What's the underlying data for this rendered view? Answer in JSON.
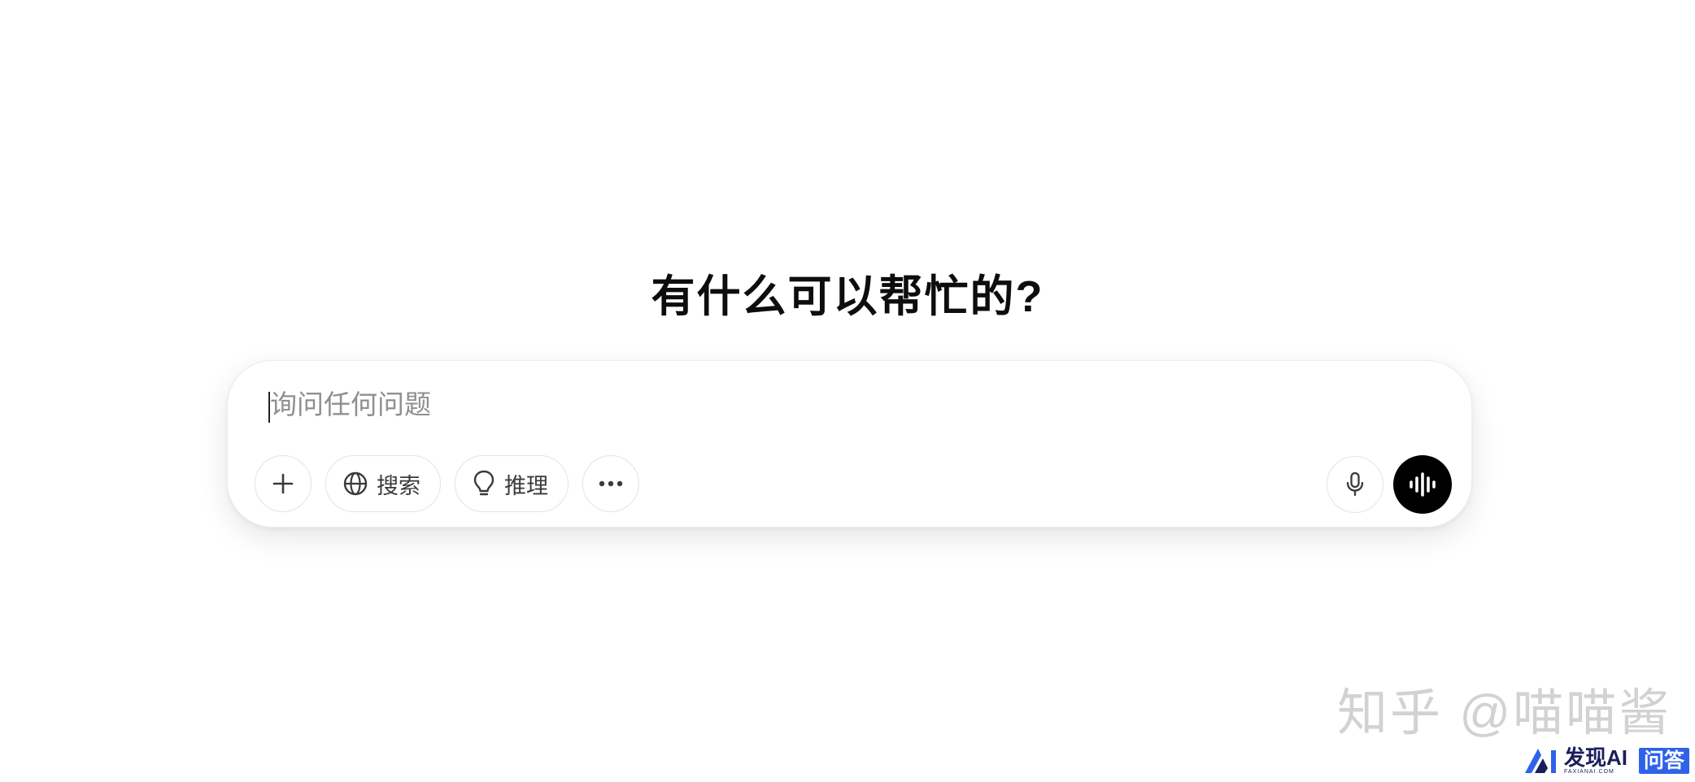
{
  "headline": "有什么可以帮忙的?",
  "composer": {
    "placeholder": "询问任何问题",
    "value": ""
  },
  "toolbar": {
    "attach_icon": "plus-icon",
    "search_label": "搜索",
    "search_icon": "globe-icon",
    "reason_label": "推理",
    "reason_icon": "lightbulb-icon",
    "more_icon": "ellipsis-icon",
    "dictate_icon": "microphone-icon",
    "voice_icon": "voice-waveform-icon"
  },
  "watermark": "知乎 @喵喵酱",
  "footer": {
    "brand": "发现AI",
    "brand_sub": "FAXIANAI.COM",
    "badge": "问答"
  },
  "colors": {
    "headline": "#0d0d0d",
    "placeholder": "#8f8f8f",
    "voice_button": "#000000",
    "badge": "#2f62e8",
    "brand": "#1a1f5c"
  }
}
